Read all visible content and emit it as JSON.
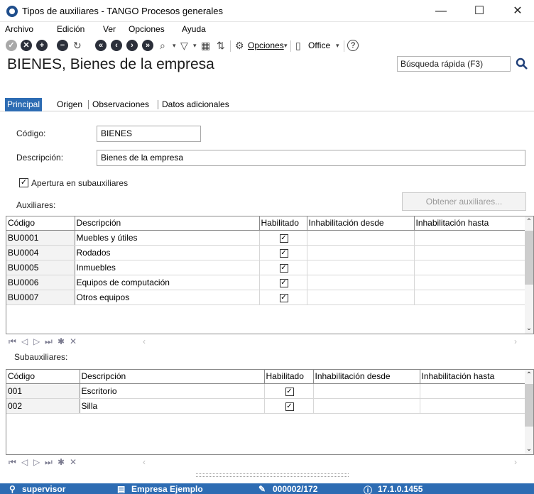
{
  "window": {
    "title": "Tipos de auxiliares - TANGO Procesos generales",
    "minimize": "—",
    "maximize": "☐",
    "close": "✕"
  },
  "menu": [
    "Archivo",
    "Edición",
    "Ver",
    "Opciones",
    "Ayuda"
  ],
  "toolbar": {
    "opciones_label": "Opciones",
    "office_label": "Office",
    "help_label": "?"
  },
  "header": {
    "title": "BIENES, Bienes de la empresa",
    "search_placeholder": "Búsqueda rápida (F3)"
  },
  "tabs": [
    "Principal",
    "Origen",
    "Observaciones",
    "Datos adicionales"
  ],
  "form": {
    "codigo_label": "Código:",
    "codigo_value": "BIENES",
    "descripcion_label": "Descripción:",
    "descripcion_value": "Bienes de la empresa",
    "apertura_label": "Apertura en subauxiliares",
    "apertura_checked": true,
    "obtener_label": "Obtener auxiliares...",
    "auxiliares_label": "Auxiliares:",
    "subauxiliares_label": "Subauxiliares:"
  },
  "columns": [
    "Código",
    "Descripción",
    "Habilitado",
    "Inhabilitación desde",
    "Inhabilitación hasta"
  ],
  "auxiliares": [
    {
      "codigo": "BU0001",
      "descripcion": "Muebles y útiles",
      "habilitado": true
    },
    {
      "codigo": "BU0004",
      "descripcion": "Rodados",
      "habilitado": true
    },
    {
      "codigo": "BU0005",
      "descripcion": "Inmuebles",
      "habilitado": true
    },
    {
      "codigo": "BU0006",
      "descripcion": "Equipos de computación",
      "habilitado": true
    },
    {
      "codigo": "BU0007",
      "descripcion": "Otros equipos",
      "habilitado": true
    }
  ],
  "subauxiliares": [
    {
      "codigo": "001",
      "descripcion": "Escritorio",
      "habilitado": true
    },
    {
      "codigo": "002",
      "descripcion": "Silla",
      "habilitado": true
    }
  ],
  "status": {
    "user": "supervisor",
    "company": "Empresa Ejemplo",
    "serial": "000002/172",
    "version": "17.1.0.1455"
  }
}
